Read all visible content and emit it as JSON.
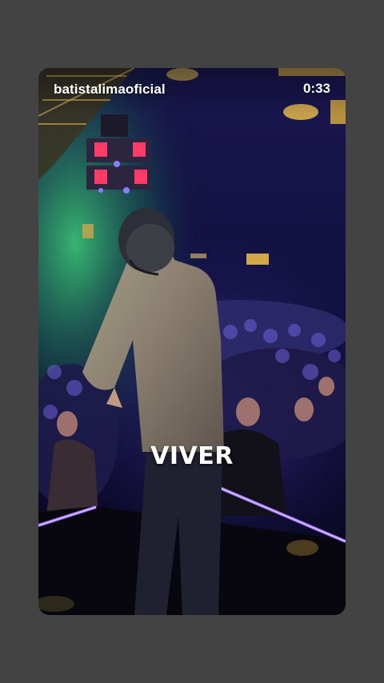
{
  "story": {
    "username": "batistalimaoficial",
    "timer": "0:33",
    "caption": "VIVER"
  },
  "colors": {
    "background": "#434343",
    "led_strip": "#9b6bff",
    "text": "#ffffff"
  }
}
